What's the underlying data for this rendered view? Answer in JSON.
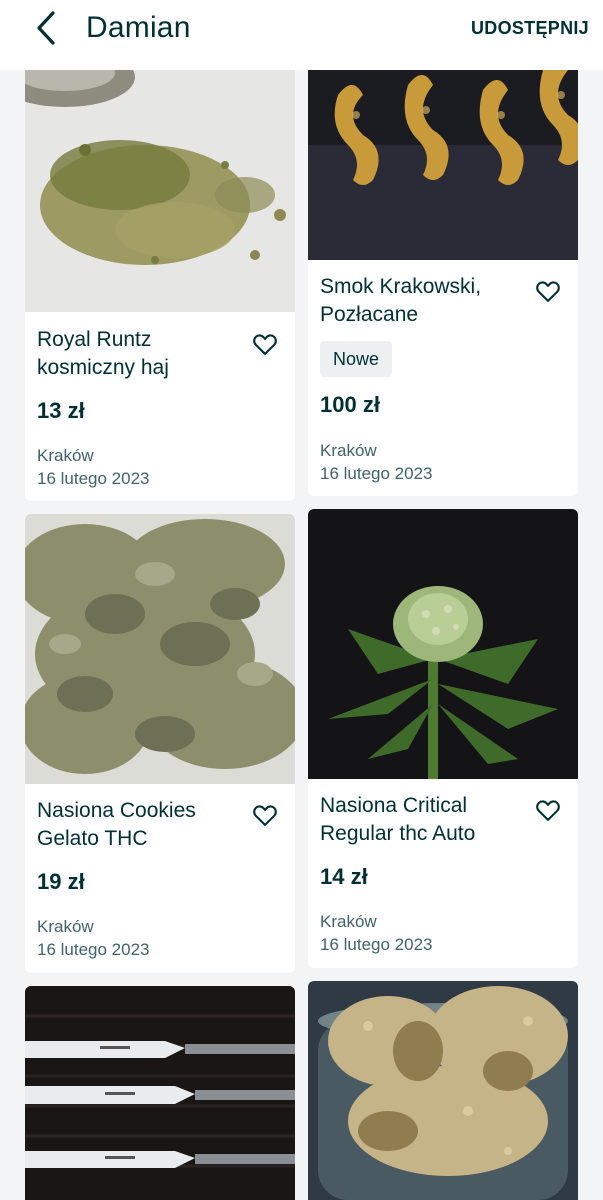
{
  "header": {
    "title": "Damian",
    "share_label": "UDOSTĘPNIJ",
    "back_icon": "chevron-left-icon"
  },
  "colors": {
    "text": "#002f34",
    "muted": "#406367",
    "background": "#f2f4f5",
    "badge_bg": "#edf0f1"
  },
  "listings": [
    {
      "title": "Royal Runtz kosmiczny haj",
      "price": "13 zł",
      "location": "Kraków",
      "date": "16 lutego 2023",
      "badge": null,
      "photo": "crumbled-plant-on-white"
    },
    {
      "title": "Smok Krakowski, Pozłacane",
      "price": "100 zł",
      "location": "Kraków",
      "date": "16 lutego 2023",
      "badge": "Nowe",
      "photo": "golden-dragon-figurines"
    },
    {
      "title": "Nasiona  Cookies Gelato THC",
      "price": "19 zł",
      "location": "Kraków",
      "date": "16 lutego 2023",
      "badge": null,
      "photo": "dried-buds-on-white"
    },
    {
      "title": "Nasiona Critical Regular thc Auto",
      "price": "14 zł",
      "location": "Kraków",
      "date": "16 lutego 2023",
      "badge": null,
      "photo": "green-plant-dark-background"
    },
    {
      "title": "",
      "price": "",
      "location": "",
      "date": "",
      "badge": null,
      "photo": "knives-on-dark-cloth"
    },
    {
      "title": "",
      "price": "",
      "location": "",
      "date": "",
      "badge": null,
      "photo": "buds-in-glass-jar"
    }
  ]
}
